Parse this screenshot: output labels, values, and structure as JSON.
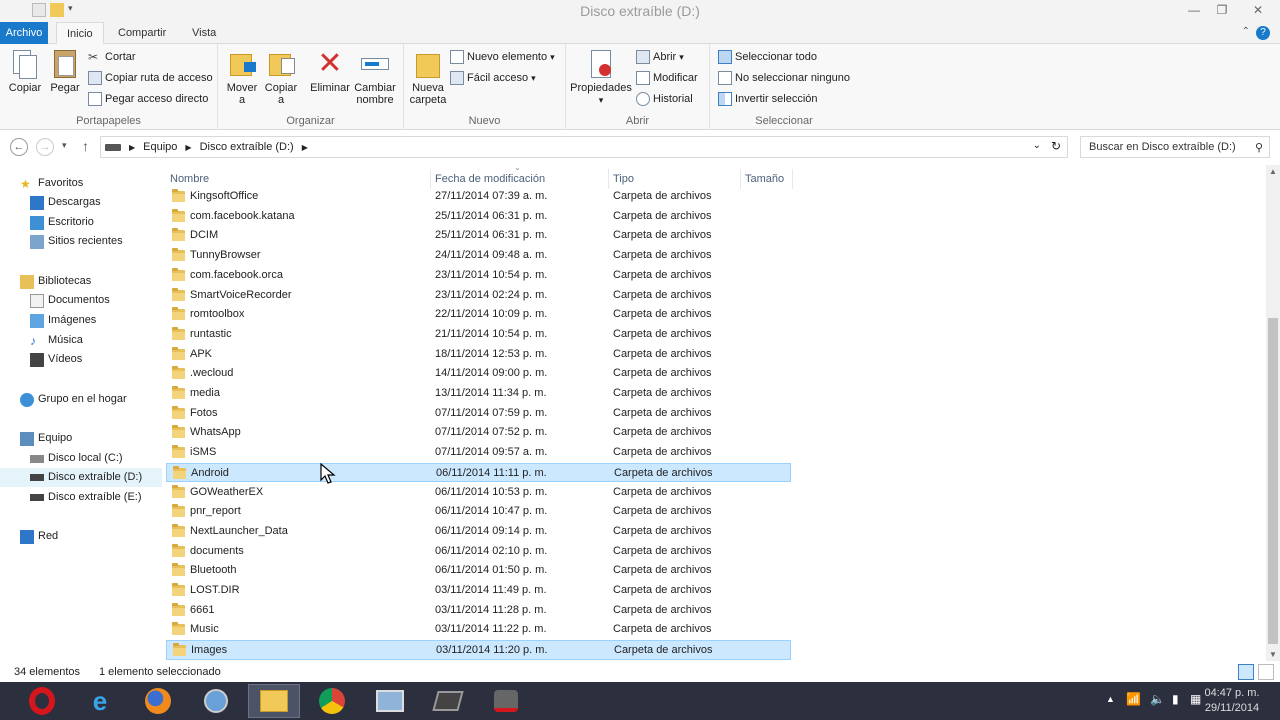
{
  "window": {
    "title": "Disco extraíble (D:)"
  },
  "tabs": [
    {
      "label": "Archivo"
    },
    {
      "label": "Inicio"
    },
    {
      "label": "Compartir"
    },
    {
      "label": "Vista"
    }
  ],
  "ribbon": {
    "portapapeles": {
      "label": "Portapapeles",
      "copiar": "Copiar",
      "pegar": "Pegar",
      "cortar": "Cortar",
      "copiar_ruta": "Copiar ruta de acceso",
      "pegar_acceso": "Pegar acceso directo"
    },
    "organizar": {
      "label": "Organizar",
      "mover": "Mover",
      "mover2": "a",
      "copiar": "Copiar",
      "copiar2": "a",
      "eliminar": "Eliminar",
      "cambiar": "Cambiar",
      "cambiar2": "nombre"
    },
    "nuevo": {
      "label": "Nuevo",
      "nueva": "Nueva",
      "carpeta": "carpeta",
      "nuevo_elemento": "Nuevo elemento",
      "facil_acceso": "Fácil acceso"
    },
    "abrir": {
      "label": "Abrir",
      "propiedades": "Propiedades",
      "abrir": "Abrir",
      "modificar": "Modificar",
      "historial": "Historial"
    },
    "seleccionar": {
      "label": "Seleccionar",
      "todo": "Seleccionar todo",
      "ninguno": "No seleccionar ninguno",
      "invertir": "Invertir selección"
    }
  },
  "address": {
    "segments": [
      "Equipo",
      "Disco extraíble (D:)"
    ],
    "search_placeholder": "Buscar en Disco extraíble (D:)"
  },
  "nav": {
    "favoritos": "Favoritos",
    "descargas": "Descargas",
    "escritorio": "Escritorio",
    "sitios": "Sitios recientes",
    "bibliotecas": "Bibliotecas",
    "documentos": "Documentos",
    "imagenes": "Imágenes",
    "musica": "Música",
    "videos": "Vídeos",
    "grupo": "Grupo en el hogar",
    "equipo": "Equipo",
    "disco_c": "Disco local (C:)",
    "disco_d": "Disco extraíble (D:)",
    "disco_e": "Disco extraíble (E:)",
    "red": "Red"
  },
  "columns": {
    "nombre": "Nombre",
    "fecha": "Fecha de modificación",
    "tipo": "Tipo",
    "tamano": "Tamaño"
  },
  "files": [
    {
      "name": "KingsoftOffice",
      "date": "27/11/2014 07:39 a. m.",
      "type": "Carpeta de archivos"
    },
    {
      "name": "com.facebook.katana",
      "date": "25/11/2014 06:31 p. m.",
      "type": "Carpeta de archivos"
    },
    {
      "name": "DCIM",
      "date": "25/11/2014 06:31 p. m.",
      "type": "Carpeta de archivos"
    },
    {
      "name": "TunnyBrowser",
      "date": "24/11/2014 09:48 a. m.",
      "type": "Carpeta de archivos"
    },
    {
      "name": "com.facebook.orca",
      "date": "23/11/2014 10:54 p. m.",
      "type": "Carpeta de archivos"
    },
    {
      "name": "SmartVoiceRecorder",
      "date": "23/11/2014 02:24 p. m.",
      "type": "Carpeta de archivos"
    },
    {
      "name": "romtoolbox",
      "date": "22/11/2014 10:09 p. m.",
      "type": "Carpeta de archivos"
    },
    {
      "name": "runtastic",
      "date": "21/11/2014 10:54 p. m.",
      "type": "Carpeta de archivos"
    },
    {
      "name": "APK",
      "date": "18/11/2014 12:53 p. m.",
      "type": "Carpeta de archivos"
    },
    {
      "name": ".wecloud",
      "date": "14/11/2014 09:00 p. m.",
      "type": "Carpeta de archivos"
    },
    {
      "name": "media",
      "date": "13/11/2014 11:34 p. m.",
      "type": "Carpeta de archivos"
    },
    {
      "name": "Fotos",
      "date": "07/11/2014 07:59 p. m.",
      "type": "Carpeta de archivos"
    },
    {
      "name": "WhatsApp",
      "date": "07/11/2014 07:52 p. m.",
      "type": "Carpeta de archivos"
    },
    {
      "name": "iSMS",
      "date": "07/11/2014 09:57 a. m.",
      "type": "Carpeta de archivos"
    },
    {
      "name": "Android",
      "date": "06/11/2014 11:11 p. m.",
      "type": "Carpeta de archivos"
    },
    {
      "name": "GOWeatherEX",
      "date": "06/11/2014 10:53 p. m.",
      "type": "Carpeta de archivos"
    },
    {
      "name": "pnr_report",
      "date": "06/11/2014 10:47 p. m.",
      "type": "Carpeta de archivos"
    },
    {
      "name": "NextLauncher_Data",
      "date": "06/11/2014 09:14 p. m.",
      "type": "Carpeta de archivos"
    },
    {
      "name": "documents",
      "date": "06/11/2014 02:10 p. m.",
      "type": "Carpeta de archivos"
    },
    {
      "name": "Bluetooth",
      "date": "06/11/2014 01:50 p. m.",
      "type": "Carpeta de archivos"
    },
    {
      "name": "LOST.DIR",
      "date": "03/11/2014 11:49 p. m.",
      "type": "Carpeta de archivos"
    },
    {
      "name": "6661",
      "date": "03/11/2014 11:28 p. m.",
      "type": "Carpeta de archivos"
    },
    {
      "name": "Music",
      "date": "03/11/2014 11:22 p. m.",
      "type": "Carpeta de archivos"
    },
    {
      "name": "Images",
      "date": "03/11/2014 11:20 p. m.",
      "type": "Carpeta de archivos"
    }
  ],
  "status": {
    "count": "34 elementos",
    "selected": "1 elemento seleccionado"
  },
  "clock": {
    "time": "04:47 p. m.",
    "date": "29/11/2014"
  },
  "colors": {
    "accent": "#1979ca",
    "selection": "#cce8ff",
    "taskbar": "#2c2f3e"
  }
}
